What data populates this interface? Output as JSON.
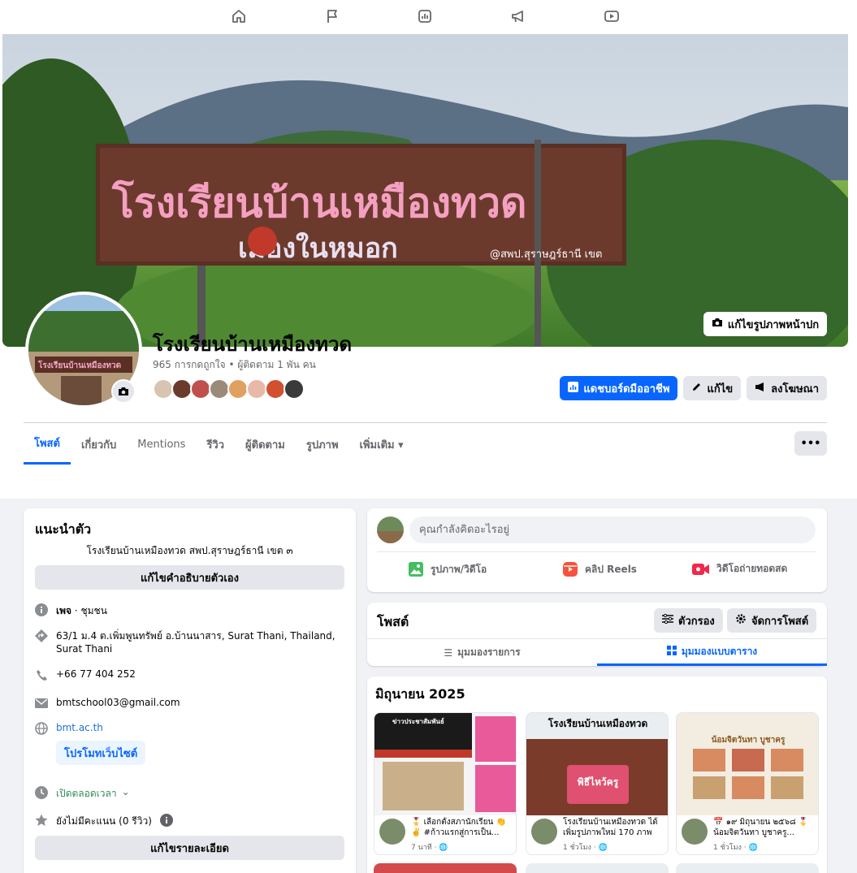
{
  "nav": {
    "icons": [
      "home-icon",
      "flag-icon",
      "insights-icon",
      "megaphone-icon",
      "video-icon"
    ]
  },
  "cover": {
    "edit_label": "แก้ไขรูปภาพหน้าปก",
    "sign_line1": "โรงเรียนบ้านเหมืองทวด",
    "sign_line2": "เมืองในหมอก",
    "sign_tag": "@สพป.สุราษฎร์ธานี เขต"
  },
  "profile": {
    "name": "โรงเรียนบ้านเหมืองทวด",
    "stats": "965 การกดถูกใจ • ผู้ติดตาม 1 พัน คน",
    "avatar_sign": "โรงเรียนบ้านเหมืองทวด"
  },
  "actions": {
    "dashboard": "แดชบอร์ดมืออาชีพ",
    "edit": "แก้ไข",
    "advertise": "ลงโฆษณา"
  },
  "tabs": [
    {
      "label": "โพสต์"
    },
    {
      "label": "เกี่ยวกับ"
    },
    {
      "label": "Mentions"
    },
    {
      "label": "รีวิว"
    },
    {
      "label": "ผู้ติดตาม"
    },
    {
      "label": "รูปภาพ"
    },
    {
      "label": "เพิ่มเติม ▾"
    }
  ],
  "more_label": "•••",
  "intro": {
    "title": "แนะนำตัว",
    "bio": "โรงเรียนบ้านเหมืองทวด สพป.สุราษฎร์ธานี เขต ๓",
    "edit_bio": "แก้ไขคำอธิบายตัวเอง",
    "category_bold": "เพจ",
    "category_rest": " · ชุมชน",
    "address": "63/1 ม.4 ต.เพิ่มพูนทรัพย์ อ.บ้านนาสาร, Surat Thani, Thailand, Surat Thani",
    "phone": "+66 77 404 252",
    "email": "bmtschool03@gmail.com",
    "website": "bmt.ac.th",
    "promote": "โปรโมทเว็บไซต์",
    "hours": "เปิดตลอดเวลา",
    "rating": "ยังไม่มีคะแนน (0 รีวิว)",
    "edit_details": "แก้ไขรายละเอียด"
  },
  "composer": {
    "placeholder": "คุณกำลังคิดอะไรอยู่",
    "photo": "รูปภาพ/วิดีโอ",
    "reels": "คลิป Reels",
    "live": "วิดีโอถ่ายทอดสด"
  },
  "posts": {
    "title": "โพสต์",
    "filter": "ตัวกรอง",
    "manage": "จัดการโพสต์",
    "list_view": "มุมมองรายการ",
    "grid_view": "มุมมองแบบตาราง"
  },
  "grid": {
    "month": "มิถุนายน 2025",
    "items": [
      {
        "caption": "🎖️ เลือกตั้งสภานักเรียน 👏✌️ #ก้าวแรกสู่การเป็น...",
        "time": "7 นาที",
        "img_title": "ข่าวประชาสัมพันธ์"
      },
      {
        "caption": "โรงเรียนบ้านเหมืองทวด ได้เพิ่มรูปภาพใหม่ 170 ภาพ",
        "time": "1 ชั่วโมง",
        "img_title": "โรงเรียนบ้านเหมืองทวด",
        "img_sub": "พิธีไหว้ครู"
      },
      {
        "caption": "📅 ๑๙ มิถุนายน ๒๕๖๘ 🎖️ น้อมจิตวันทา บูชาครู...",
        "time": "1 ชั่วโมง",
        "img_title": "น้อมจิตวันทา บูชาครู"
      }
    ]
  },
  "colors": {
    "accent": "#0866ff",
    "bg": "#f0f2f5",
    "green": "#2e8b57"
  }
}
